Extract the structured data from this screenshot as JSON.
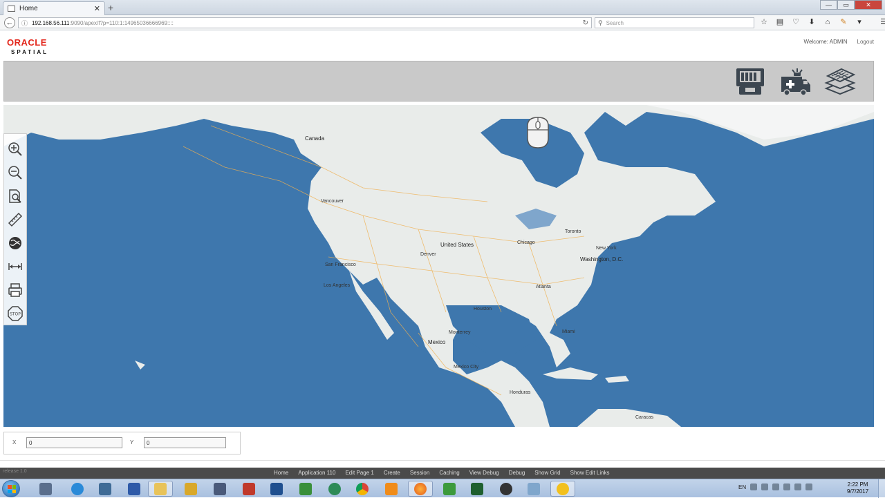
{
  "browser": {
    "tab_title": "Home",
    "tab_close": "✕",
    "new_tab": "+",
    "url_host": "192.168.56.111",
    "url_path": ":9090/apex/f?p=110:1:14965036666969::::",
    "search_placeholder": "Search"
  },
  "app": {
    "logo_text": "ORACLE",
    "logo_sub": "SPATIAL",
    "welcome": "Welcome: ADMIN",
    "logout": "Logout"
  },
  "map": {
    "labels": {
      "canada": "Canada",
      "united_states": "United States",
      "mexico": "Mexico",
      "honduras": "Honduras",
      "caracas": "Caracas",
      "vancouver": "Vancouver",
      "san_francisco": "San Francisco",
      "los_angeles": "Los Angeles",
      "denver": "Denver",
      "chicago": "Chicago",
      "toronto": "Toronto",
      "new_york": "New York",
      "washington": "Washington, D.C.",
      "atlanta": "Atlanta",
      "houston": "Houston",
      "monterrey": "Monterrey",
      "mexico_city": "Mexico City",
      "miami": "Miami"
    }
  },
  "coords": {
    "x_label": "X",
    "y_label": "Y",
    "x_value": "0",
    "y_value": "0"
  },
  "devbar": {
    "release": "release 1.0",
    "links": [
      "Home",
      "Application 110",
      "Edit Page 1",
      "Create",
      "Session",
      "Caching",
      "View Debug",
      "Debug",
      "Show Grid",
      "Show Edit Links"
    ]
  },
  "taskbar": {
    "language": "EN",
    "time": "2:22 PM",
    "date": "9/7/2017"
  },
  "colors": {
    "ocean": "#3e77ad",
    "land": "#e9ecea",
    "roads": "#f0b050",
    "oracle_red": "#e3261b"
  }
}
